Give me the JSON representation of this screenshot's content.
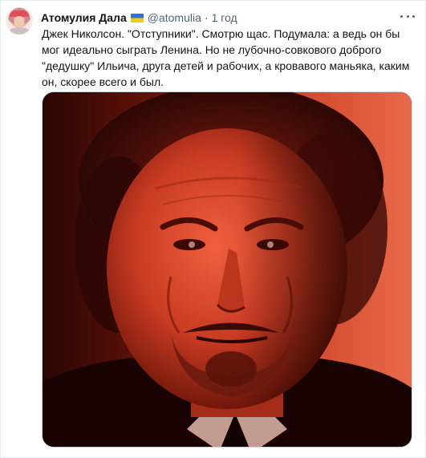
{
  "tweet": {
    "author_name": "Атомулия Дала",
    "flag_icon": "ukraine-flag-icon",
    "handle": "@atomulia",
    "separator": "·",
    "time": "1 год",
    "text_lines": [
      "Джек Николсон. \"Отступники\". Смотрю щас. Подумала: а ведь он бы",
      "мог идеально сыграть Ленина. Но не лубочно-совкового доброго",
      "\"дедушку\" Ильича, друга детей и рабочих, а кровавого маньяка, каким",
      "он, скорее всего и был."
    ],
    "media_description": "photo"
  },
  "colors": {
    "name": "#0f1419",
    "secondary": "#536471",
    "flag_top": "#2f6fd6",
    "flag_bottom": "#f6c90e"
  }
}
